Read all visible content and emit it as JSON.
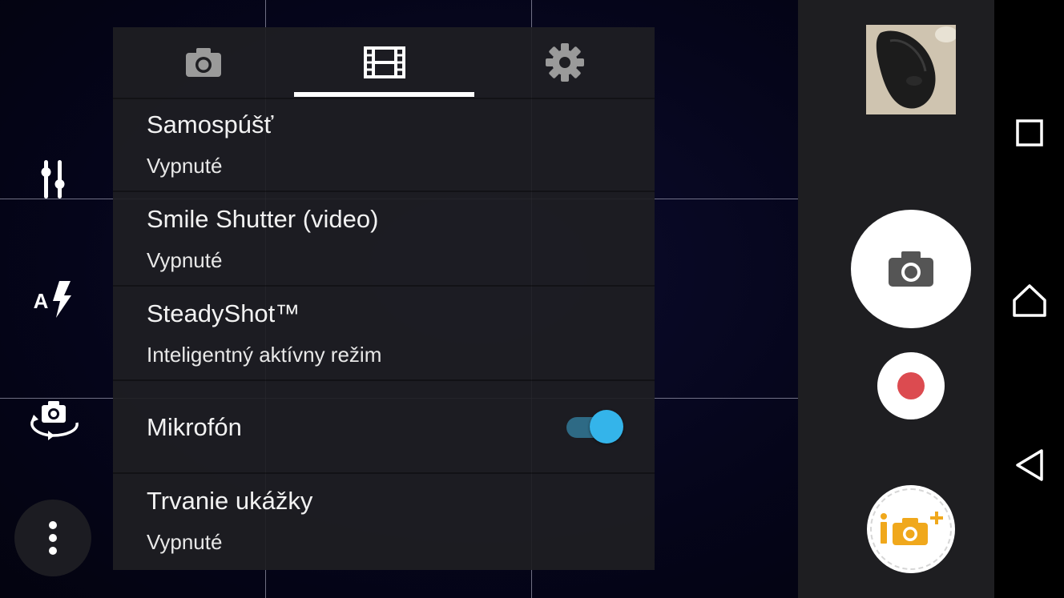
{
  "tabs": [
    {
      "name": "photo",
      "icon": "camera-icon"
    },
    {
      "name": "video",
      "icon": "film-icon",
      "selected": true
    },
    {
      "name": "settings",
      "icon": "gear-icon"
    }
  ],
  "settings": {
    "self_timer": {
      "title": "Samospúšť",
      "value": "Vypnuté"
    },
    "smile_shutter": {
      "title": "Smile Shutter (video)",
      "value": "Vypnuté"
    },
    "steadyshot": {
      "title": "SteadyShot™",
      "value": "Inteligentný aktívny režim"
    },
    "microphone": {
      "title": "Mikrofón",
      "enabled": true
    },
    "preview_duration": {
      "title": "Trvanie ukážky",
      "value": "Vypnuté"
    }
  },
  "left_toolbar": {
    "icons": [
      "adjust-sliders-icon",
      "auto-flash-icon",
      "switch-camera-icon",
      "more-options-icon"
    ],
    "flash_mode_letter": "A"
  },
  "colors": {
    "accent": "#34b4ea",
    "record": "#dc4b50",
    "info_eye": "#f0a81c",
    "panel_bg": "#1e1e22",
    "controls_bg": "#1e1e21"
  },
  "nav_icons": [
    "recent-apps-icon",
    "home-icon",
    "back-icon"
  ]
}
